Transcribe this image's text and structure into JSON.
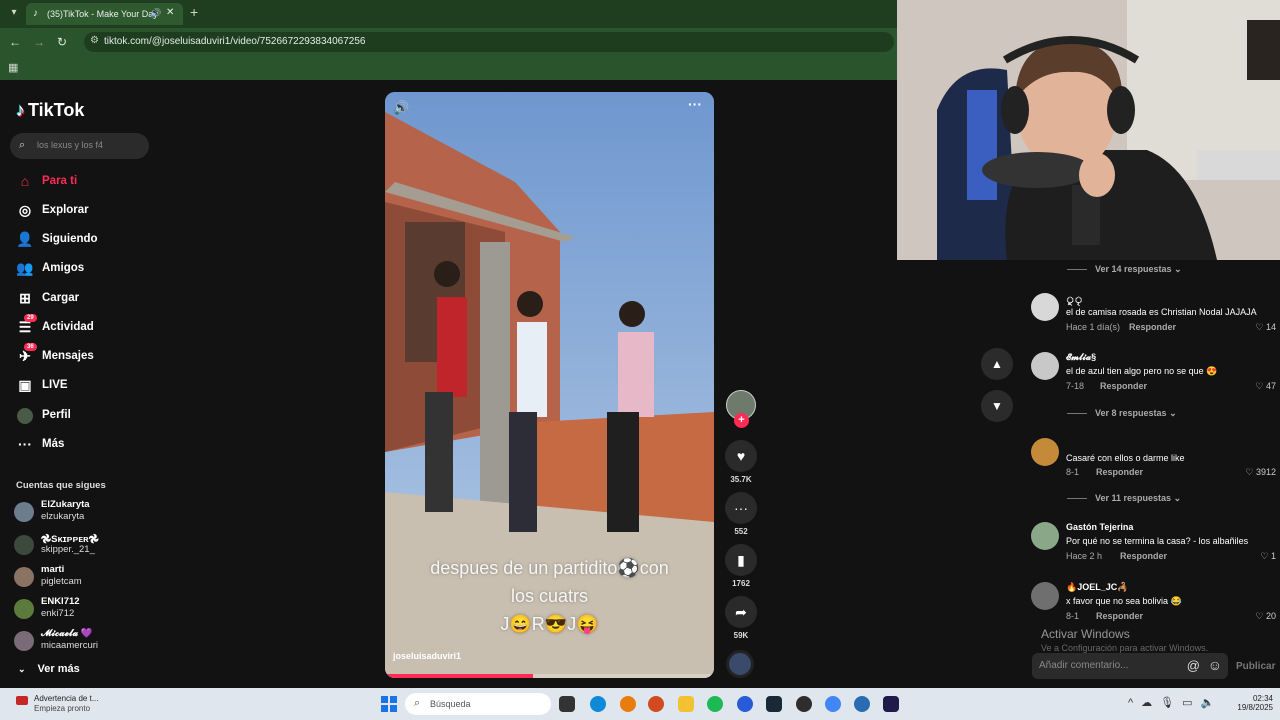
{
  "browser": {
    "tab_title": "(35)TikTok - Make Your Day",
    "url": "tiktok.com/@joseluisaduviri1/video/7526672293834067256"
  },
  "sidebar": {
    "logo": "TikTok",
    "search_placeholder": "los lexus y los f4",
    "nav": [
      {
        "label": "Para ti",
        "icon": "home-icon",
        "active": true
      },
      {
        "label": "Explorar",
        "icon": "compass-icon"
      },
      {
        "label": "Siguiendo",
        "icon": "following-icon"
      },
      {
        "label": "Amigos",
        "icon": "friends-icon"
      },
      {
        "label": "Cargar",
        "icon": "upload-icon"
      },
      {
        "label": "Actividad",
        "icon": "activity-icon",
        "badge": "29"
      },
      {
        "label": "Mensajes",
        "icon": "messages-icon",
        "badge": "36"
      },
      {
        "label": "LIVE",
        "icon": "live-icon"
      },
      {
        "label": "Perfil",
        "icon": "profile-icon"
      },
      {
        "label": "Más",
        "icon": "more-icon"
      }
    ],
    "following_title": "Cuentas que sigues",
    "following": [
      {
        "name": "ElZukaryta",
        "handle": "elzukaryta"
      },
      {
        "name": "𖣘Sᴋɪᴘᴘᴇʀ𖣘",
        "handle": "skipper._21_"
      },
      {
        "name": "marti",
        "handle": "pigletcam"
      },
      {
        "name": "ENKI712",
        "handle": "enki712"
      },
      {
        "name": "𝓜𝓲𝓬𝓪𝓮𝓵𝓪 💜",
        "handle": "micaamercuri"
      }
    ],
    "see_more": "Ver más"
  },
  "video": {
    "caption_line1": "despues de un partidito⚽con",
    "caption_line2": "los cuatrs",
    "caption_line3": "J😄R😎J😝",
    "author": "joseluisaduviri1",
    "progress": 0.45
  },
  "actions": {
    "likes": "35.7K",
    "comments": "552",
    "saves": "1762",
    "shares": "59K"
  },
  "comments": {
    "view_replies_14": "Ver 14 respuestas",
    "items": [
      {
        "user": "ু◌ৃ",
        "text": "el de camisa rosada es Christian Nodal JAJAJA",
        "meta": "Hace 1 día(s)",
        "reply": "Responder",
        "likes": "14"
      },
      {
        "user": "𝓔𝓶𝓵𝓲𝓪§",
        "text": "el de azul tien algo pero no se que 😍",
        "meta": "7-18",
        "reply": "Responder",
        "likes": "47"
      },
      {
        "user": "",
        "text": "Casaré con ellos o darme like",
        "meta": "8-1",
        "reply": "Responder",
        "likes": "3912"
      },
      {
        "user": "Gastón Tejerina",
        "text": "Por qué no se termina la casa? - los albañiles",
        "meta": "Hace 2 h",
        "reply": "Responder",
        "likes": "1"
      },
      {
        "user": "🔥JOEL_JC🦂",
        "text": "x favor que no sea bolivia 😂",
        "meta": "8-1",
        "reply": "Responder",
        "likes": "20"
      }
    ],
    "view_replies_8": "Ver 8 respuestas",
    "view_replies_11": "Ver 11 respuestas",
    "activate_title": "Activar Windows",
    "activate_sub": "Ve a Configuración para activar Windows.",
    "add_placeholder": "Añadir comentario...",
    "publish": "Publicar"
  },
  "taskbar": {
    "warn_title": "Advertencia de t...",
    "warn_sub": "Empieza pronto",
    "search_placeholder": "Búsqueda",
    "time": "02:34",
    "date": "19/8/2025"
  },
  "colors": {
    "accent": "#fe2c55",
    "chrome_green": "#2a542c"
  }
}
